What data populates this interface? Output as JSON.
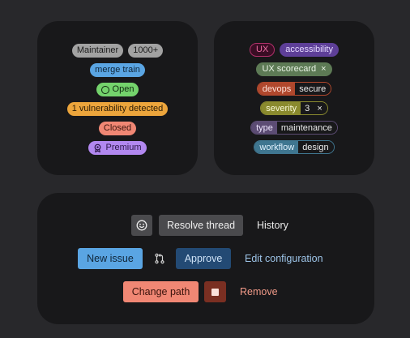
{
  "badges": {
    "maintainer": "Maintainer",
    "count": "1000+",
    "merge_train": "merge train",
    "open": "Open",
    "vulnerability": "1 vulnerability detected",
    "closed": "Closed",
    "premium": "Premium"
  },
  "labels": {
    "ux": "UX",
    "accessibility": "accessibility",
    "ux_scorecard": "UX scorecard",
    "devops_key": "devops",
    "devops_value": "secure",
    "severity_key": "severity",
    "severity_value": "3",
    "type_key": "type",
    "type_value": "maintenance",
    "workflow_key": "workflow",
    "workflow_value": "design",
    "remove_glyph": "×"
  },
  "buttons": {
    "resolve_thread": "Resolve thread",
    "history": "History",
    "new_issue": "New issue",
    "approve": "Approve",
    "edit_configuration": "Edit configuration",
    "change_path": "Change path",
    "remove": "Remove"
  },
  "icons": {
    "emoji": "smiley-icon",
    "merge_request": "merge-request-icon",
    "stop": "stop-icon",
    "open_status": "status-open-icon",
    "premium": "premium-seal-icon"
  },
  "colors": {
    "page_bg": "#28282b",
    "card_bg": "#18181a",
    "primary": "#5aa5e3",
    "confirm": "#234a74",
    "danger": "#f08774"
  }
}
